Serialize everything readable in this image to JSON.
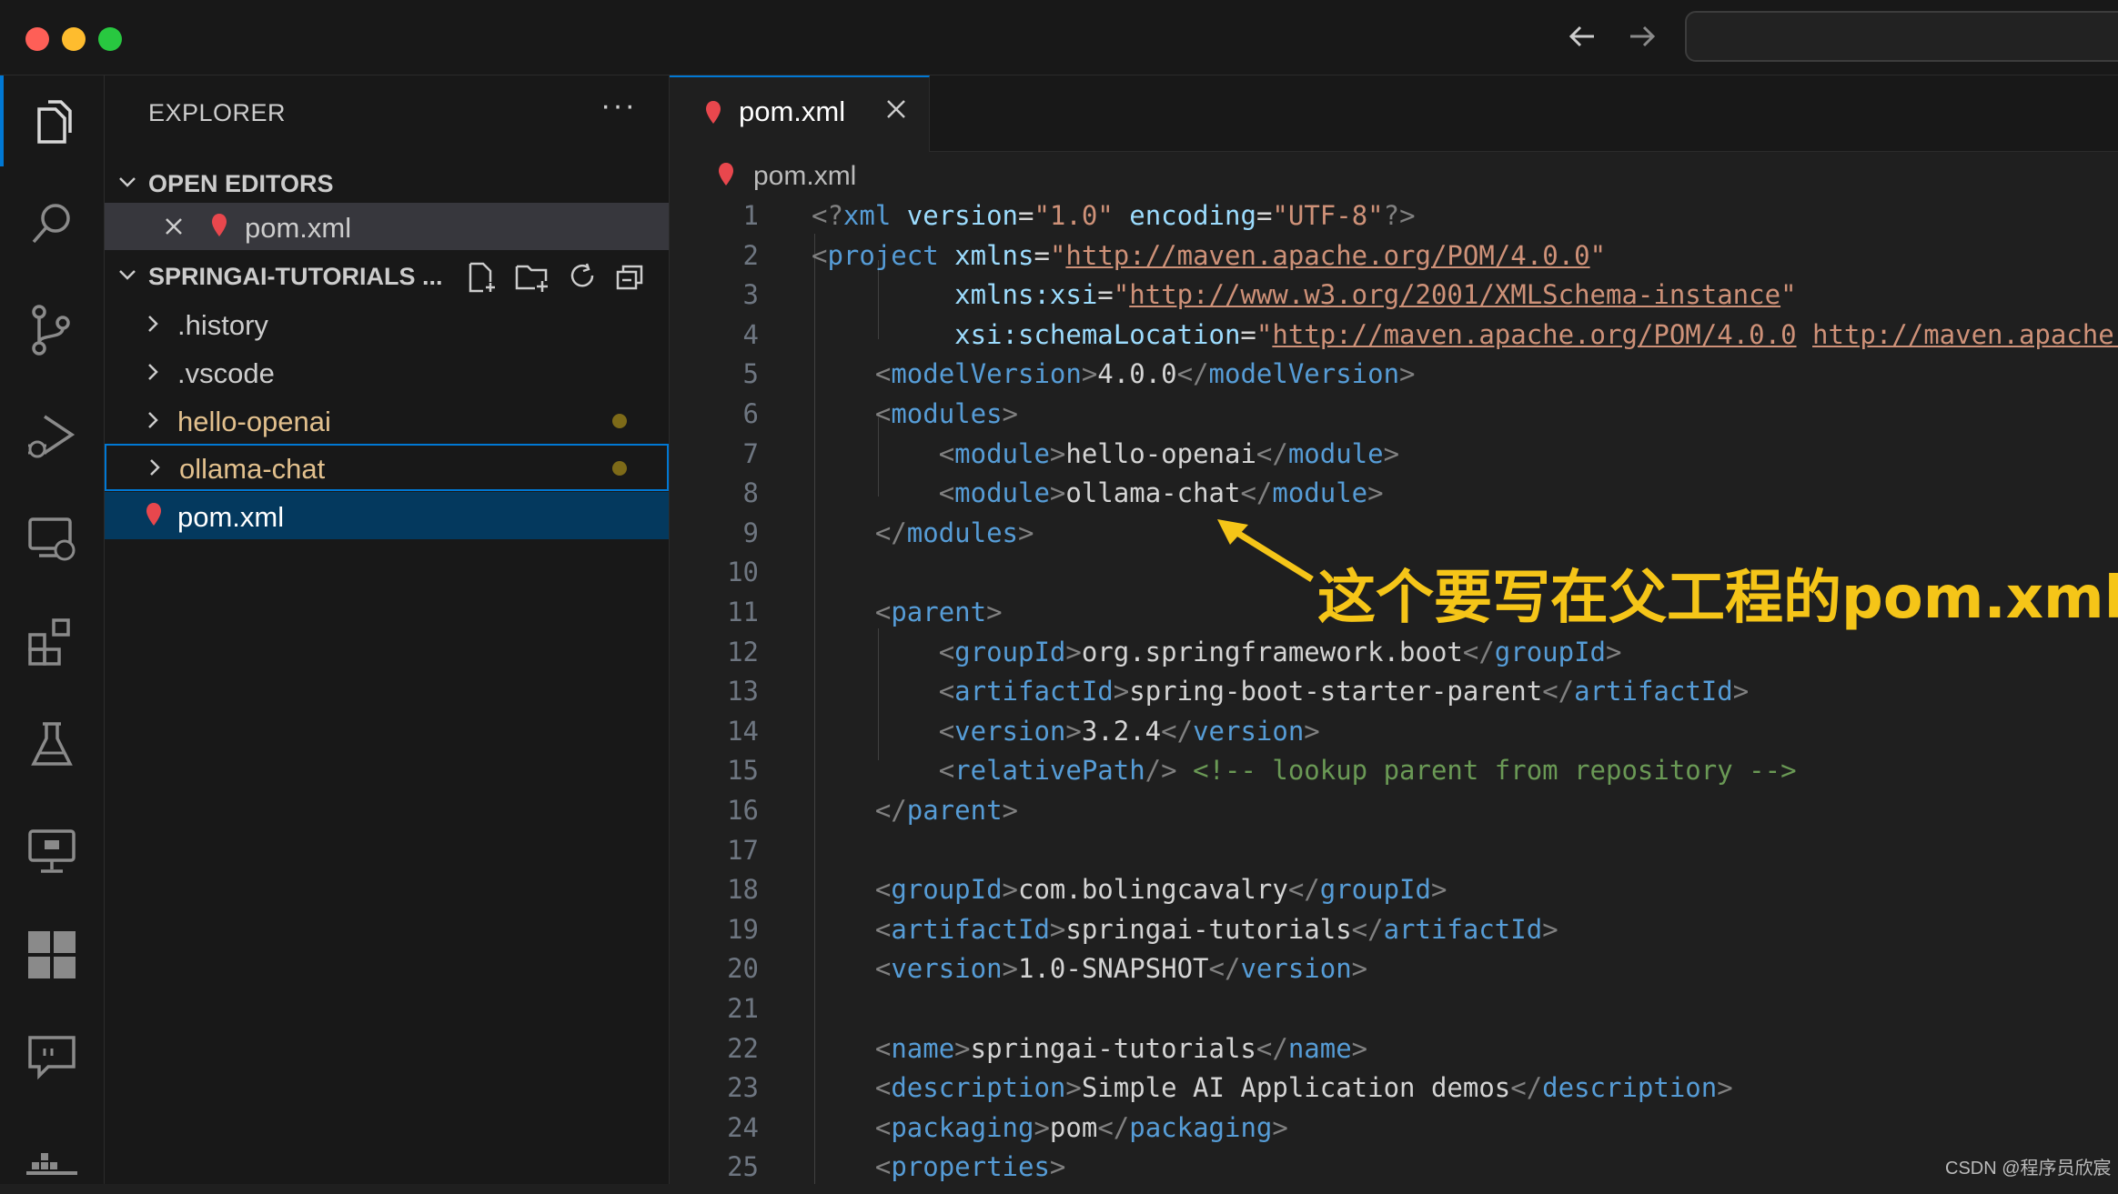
{
  "window": {
    "traffic_lights": [
      "#fe5f57",
      "#febc2e",
      "#28c840"
    ]
  },
  "activity_bar": {
    "items": [
      "explorer-icon",
      "search-icon",
      "source-control-icon",
      "run-debug-icon",
      "remote-explorer-icon",
      "extensions-icon",
      "testing-icon",
      "monitor-icon",
      "grid-icon",
      "chat-icon",
      "docker-icon"
    ]
  },
  "sidebar": {
    "title": "EXPLORER",
    "more": "···",
    "open_editors": {
      "label": "OPEN EDITORS",
      "items": [
        {
          "label": "pom.xml"
        }
      ]
    },
    "project": {
      "label": "SPRINGAI-TUTORIALS ...",
      "items": [
        {
          "label": ".history",
          "color": "#cccccc"
        },
        {
          "label": ".vscode",
          "color": "#cccccc"
        },
        {
          "label": "hello-openai",
          "color": "#e2c08d"
        },
        {
          "label": "ollama-chat",
          "color": "#e2c08d"
        },
        {
          "label": "pom.xml",
          "color": "#ffffff"
        }
      ]
    }
  },
  "editor": {
    "tab": {
      "label": "pom.xml"
    },
    "breadcrumb": "pom.xml",
    "lines": [
      {
        "n": "1",
        "tokens": [
          [
            "br",
            "<?"
          ],
          [
            "tag",
            "xml"
          ],
          [
            "text",
            " "
          ],
          [
            "attr",
            "version"
          ],
          [
            "text",
            "="
          ],
          [
            "str",
            "\"1.0\""
          ],
          [
            "text",
            " "
          ],
          [
            "attr",
            "encoding"
          ],
          [
            "text",
            "="
          ],
          [
            "str",
            "\"UTF-8\""
          ],
          [
            "br",
            "?>"
          ]
        ]
      },
      {
        "n": "2",
        "tokens": [
          [
            "br",
            "<"
          ],
          [
            "tag",
            "project"
          ],
          [
            "text",
            " "
          ],
          [
            "attr",
            "xmlns"
          ],
          [
            "text",
            "="
          ],
          [
            "str",
            "\""
          ],
          [
            "url",
            "http://maven.apache.org/POM/4.0.0"
          ],
          [
            "str",
            "\""
          ]
        ]
      },
      {
        "n": "3",
        "tokens": [
          [
            "text",
            "         "
          ],
          [
            "attr",
            "xmlns:xsi"
          ],
          [
            "text",
            "="
          ],
          [
            "str",
            "\""
          ],
          [
            "url",
            "http://www.w3.org/2001/XMLSchema-instance"
          ],
          [
            "str",
            "\""
          ]
        ]
      },
      {
        "n": "4",
        "tokens": [
          [
            "text",
            "         "
          ],
          [
            "attr",
            "xsi:schemaLocation"
          ],
          [
            "text",
            "="
          ],
          [
            "str",
            "\""
          ],
          [
            "url",
            "http://maven.apache.org/POM/4.0.0"
          ],
          [
            "text",
            " "
          ],
          [
            "url",
            "http://maven.apache."
          ]
        ]
      },
      {
        "n": "5",
        "tokens": [
          [
            "text",
            "    "
          ],
          [
            "br",
            "<"
          ],
          [
            "tag",
            "modelVersion"
          ],
          [
            "br",
            ">"
          ],
          [
            "text",
            "4.0.0"
          ],
          [
            "br",
            "</"
          ],
          [
            "tag",
            "modelVersion"
          ],
          [
            "br",
            ">"
          ]
        ]
      },
      {
        "n": "6",
        "tokens": [
          [
            "text",
            "    "
          ],
          [
            "br",
            "<"
          ],
          [
            "tag",
            "modules"
          ],
          [
            "br",
            ">"
          ]
        ]
      },
      {
        "n": "7",
        "tokens": [
          [
            "text",
            "        "
          ],
          [
            "br",
            "<"
          ],
          [
            "tag",
            "module"
          ],
          [
            "br",
            ">"
          ],
          [
            "text",
            "hello-openai"
          ],
          [
            "br",
            "</"
          ],
          [
            "tag",
            "module"
          ],
          [
            "br",
            ">"
          ]
        ]
      },
      {
        "n": "8",
        "tokens": [
          [
            "text",
            "        "
          ],
          [
            "br",
            "<"
          ],
          [
            "tag",
            "module"
          ],
          [
            "br",
            ">"
          ],
          [
            "text",
            "ollama-chat"
          ],
          [
            "br",
            "</"
          ],
          [
            "tag",
            "module"
          ],
          [
            "br",
            ">"
          ]
        ]
      },
      {
        "n": "9",
        "tokens": [
          [
            "text",
            "    "
          ],
          [
            "br",
            "</"
          ],
          [
            "tag",
            "modules"
          ],
          [
            "br",
            ">"
          ]
        ]
      },
      {
        "n": "10",
        "tokens": []
      },
      {
        "n": "11",
        "tokens": [
          [
            "text",
            "    "
          ],
          [
            "br",
            "<"
          ],
          [
            "tag",
            "parent"
          ],
          [
            "br",
            ">"
          ]
        ]
      },
      {
        "n": "12",
        "tokens": [
          [
            "text",
            "        "
          ],
          [
            "br",
            "<"
          ],
          [
            "tag",
            "groupId"
          ],
          [
            "br",
            ">"
          ],
          [
            "text",
            "org.springframework.boot"
          ],
          [
            "br",
            "</"
          ],
          [
            "tag",
            "groupId"
          ],
          [
            "br",
            ">"
          ]
        ]
      },
      {
        "n": "13",
        "tokens": [
          [
            "text",
            "        "
          ],
          [
            "br",
            "<"
          ],
          [
            "tag",
            "artifactId"
          ],
          [
            "br",
            ">"
          ],
          [
            "text",
            "spring-boot-starter-parent"
          ],
          [
            "br",
            "</"
          ],
          [
            "tag",
            "artifactId"
          ],
          [
            "br",
            ">"
          ]
        ]
      },
      {
        "n": "14",
        "tokens": [
          [
            "text",
            "        "
          ],
          [
            "br",
            "<"
          ],
          [
            "tag",
            "version"
          ],
          [
            "br",
            ">"
          ],
          [
            "text",
            "3.2.4"
          ],
          [
            "br",
            "</"
          ],
          [
            "tag",
            "version"
          ],
          [
            "br",
            ">"
          ]
        ]
      },
      {
        "n": "15",
        "tokens": [
          [
            "text",
            "        "
          ],
          [
            "br",
            "<"
          ],
          [
            "tag",
            "relativePath"
          ],
          [
            "br",
            "/>"
          ],
          [
            "text",
            " "
          ],
          [
            "com",
            "<!-- lookup parent from repository -->"
          ]
        ]
      },
      {
        "n": "16",
        "tokens": [
          [
            "text",
            "    "
          ],
          [
            "br",
            "</"
          ],
          [
            "tag",
            "parent"
          ],
          [
            "br",
            ">"
          ]
        ]
      },
      {
        "n": "17",
        "tokens": []
      },
      {
        "n": "18",
        "tokens": [
          [
            "text",
            "    "
          ],
          [
            "br",
            "<"
          ],
          [
            "tag",
            "groupId"
          ],
          [
            "br",
            ">"
          ],
          [
            "text",
            "com.bolingcavalry"
          ],
          [
            "br",
            "</"
          ],
          [
            "tag",
            "groupId"
          ],
          [
            "br",
            ">"
          ]
        ]
      },
      {
        "n": "19",
        "tokens": [
          [
            "text",
            "    "
          ],
          [
            "br",
            "<"
          ],
          [
            "tag",
            "artifactId"
          ],
          [
            "br",
            ">"
          ],
          [
            "text",
            "springai-tutorials"
          ],
          [
            "br",
            "</"
          ],
          [
            "tag",
            "artifactId"
          ],
          [
            "br",
            ">"
          ]
        ]
      },
      {
        "n": "20",
        "tokens": [
          [
            "text",
            "    "
          ],
          [
            "br",
            "<"
          ],
          [
            "tag",
            "version"
          ],
          [
            "br",
            ">"
          ],
          [
            "text",
            "1.0-SNAPSHOT"
          ],
          [
            "br",
            "</"
          ],
          [
            "tag",
            "version"
          ],
          [
            "br",
            ">"
          ]
        ]
      },
      {
        "n": "21",
        "tokens": []
      },
      {
        "n": "22",
        "tokens": [
          [
            "text",
            "    "
          ],
          [
            "br",
            "<"
          ],
          [
            "tag",
            "name"
          ],
          [
            "br",
            ">"
          ],
          [
            "text",
            "springai-tutorials"
          ],
          [
            "br",
            "</"
          ],
          [
            "tag",
            "name"
          ],
          [
            "br",
            ">"
          ]
        ]
      },
      {
        "n": "23",
        "tokens": [
          [
            "text",
            "    "
          ],
          [
            "br",
            "<"
          ],
          [
            "tag",
            "description"
          ],
          [
            "br",
            ">"
          ],
          [
            "text",
            "Simple AI Application demos"
          ],
          [
            "br",
            "</"
          ],
          [
            "tag",
            "description"
          ],
          [
            "br",
            ">"
          ]
        ]
      },
      {
        "n": "24",
        "tokens": [
          [
            "text",
            "    "
          ],
          [
            "br",
            "<"
          ],
          [
            "tag",
            "packaging"
          ],
          [
            "br",
            ">"
          ],
          [
            "text",
            "pom"
          ],
          [
            "br",
            "</"
          ],
          [
            "tag",
            "packaging"
          ],
          [
            "br",
            ">"
          ]
        ]
      },
      {
        "n": "25",
        "tokens": [
          [
            "text",
            "    "
          ],
          [
            "br",
            "<"
          ],
          [
            "tag",
            "properties"
          ],
          [
            "br",
            ">"
          ]
        ]
      }
    ]
  },
  "annotation": {
    "text": "这个要写在父工程的pom.xml中",
    "color": "#f5c518"
  },
  "watermark": "CSDN @程序员欣宸"
}
